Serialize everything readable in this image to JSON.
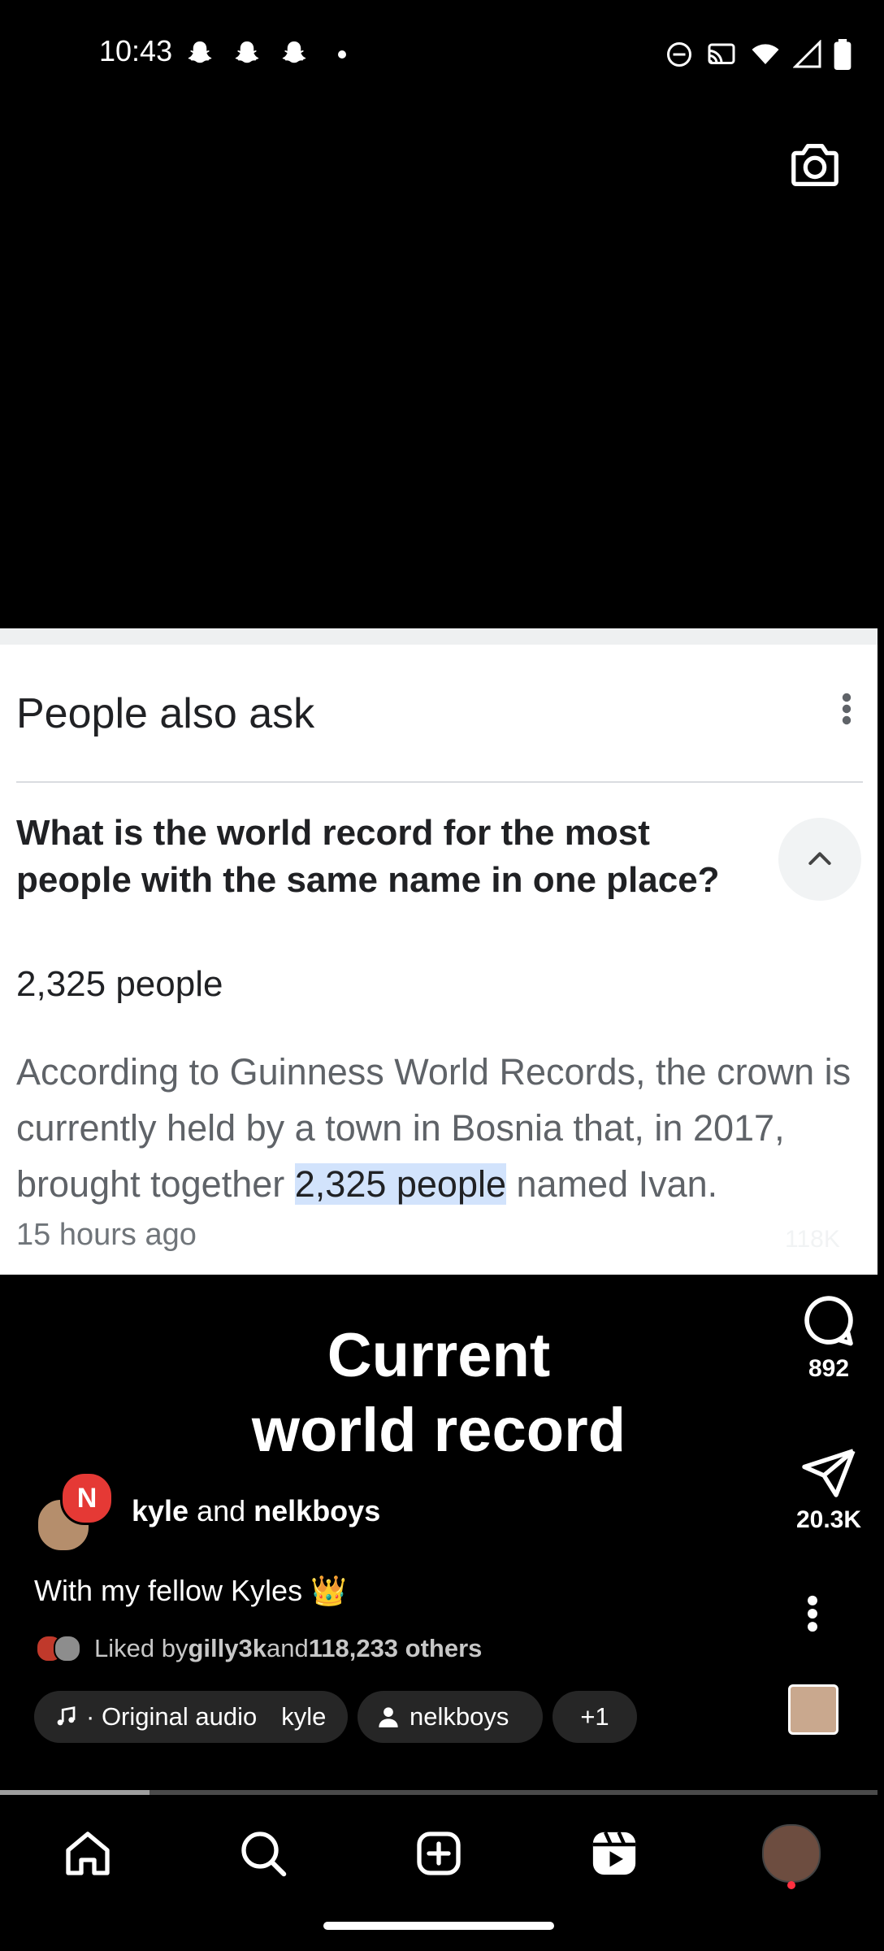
{
  "status_bar": {
    "time": "10:43"
  },
  "search_card": {
    "section_title": "People also ask",
    "question": "What is the world record for the most people with the same name in one place?",
    "short_answer": "2,325 people",
    "snippet_before": "According to Guinness World Records, the crown is currently held by a town in Bosnia that, in 2017, brought together ",
    "snippet_highlight": "2,325 people",
    "snippet_after": " named Ivan.",
    "timestamp": "15 hours ago",
    "faint_count": "118K"
  },
  "reel": {
    "overlay_title_line1": "Current",
    "overlay_title_line2": "world record",
    "comments_count": "892",
    "shares_count": "20.3K",
    "author_primary": "kyle",
    "author_joiner": " and ",
    "author_secondary": "nelkboys",
    "collab_badge_letter": "N",
    "caption": "With my fellow Kyles 👑",
    "liked_prefix": "Liked by ",
    "liked_user": "gilly3k",
    "liked_joiner": " and ",
    "liked_others": "118,233 others",
    "audio_label": "Original audio",
    "audio_author": "kyle",
    "tagged_user": "nelkboys",
    "extra_tags": "+1",
    "progress_fraction": 0.17
  },
  "nav": {
    "items": [
      "home",
      "search",
      "create",
      "reels",
      "profile"
    ]
  }
}
